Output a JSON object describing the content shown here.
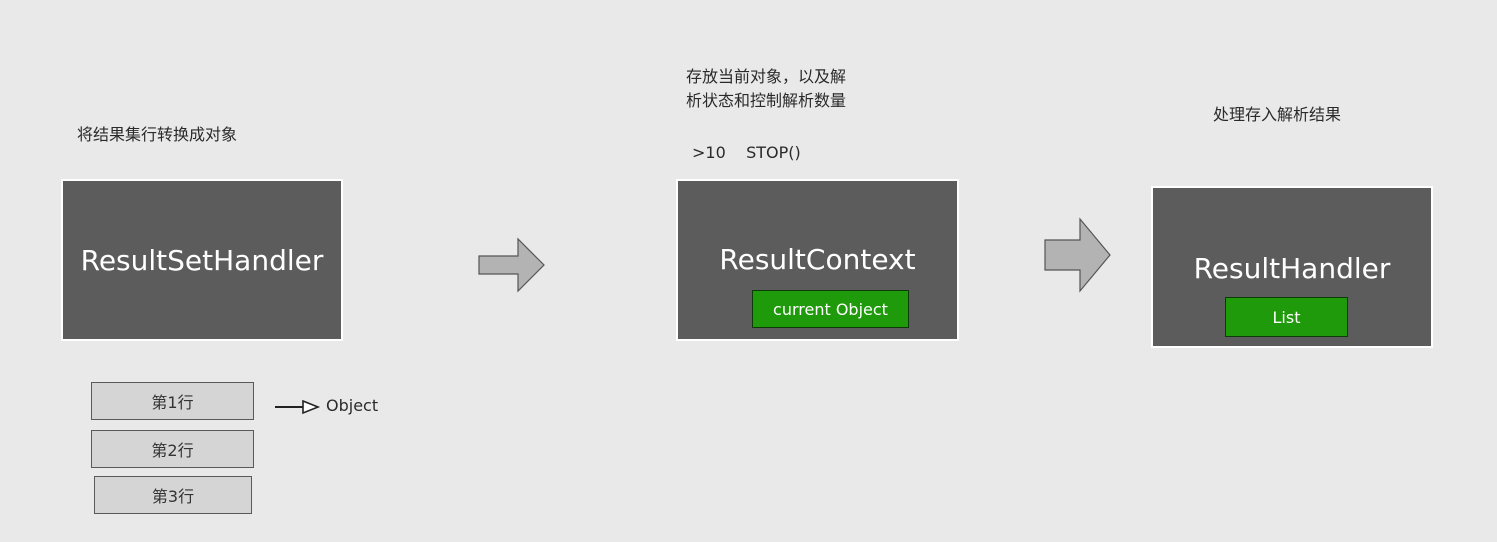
{
  "captions": {
    "handler_caption": "将结果集行转换成对象",
    "context_caption": "存放当前对象，以及解\n析状态和控制解析数量",
    "stop_condition": ">10    STOP()",
    "result_handler_caption": "处理存入解析结果"
  },
  "boxes": {
    "result_set_handler": "ResultSetHandler",
    "result_context": "ResultContext",
    "result_context_tag": "current Object",
    "result_handler": "ResultHandler",
    "result_handler_tag": "List"
  },
  "rows": [
    "第1行",
    "第2行",
    "第3行"
  ],
  "row_arrow_label": "Object",
  "colors": {
    "background": "#e9e9e9",
    "box_fill": "#5c5c5c",
    "tag_green": "#1f9a0b",
    "row_fill": "#d5d5d5",
    "arrow_fill": "#b3b3b3"
  }
}
